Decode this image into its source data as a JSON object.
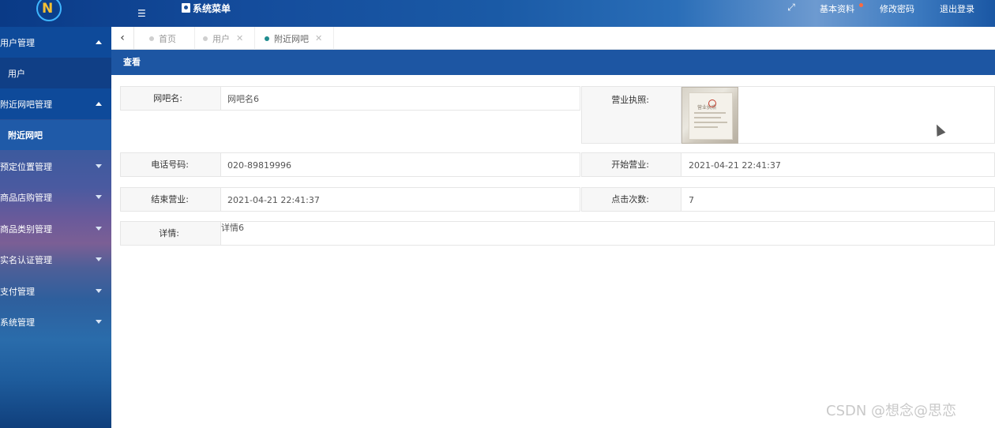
{
  "header": {
    "system_menu": "系统菜单",
    "links": [
      "基本资料",
      "修改密码",
      "退出登录"
    ],
    "colors": {
      "notify": "#ff6a3d"
    }
  },
  "sidebar": {
    "groups": [
      {
        "label": "用户管理",
        "expanded": true,
        "children": [
          "用户"
        ]
      },
      {
        "label": "附近网吧管理",
        "expanded": true,
        "children": [
          "附近网吧"
        ]
      },
      {
        "label": "预定位置管理",
        "expanded": false
      },
      {
        "label": "商品店购管理",
        "expanded": false
      },
      {
        "label": "商品类别管理",
        "expanded": false
      },
      {
        "label": "实名认证管理",
        "expanded": false
      },
      {
        "label": "支付管理",
        "expanded": false
      },
      {
        "label": "系统管理",
        "expanded": false
      }
    ]
  },
  "tabs": [
    {
      "label": "首页",
      "active": false
    },
    {
      "label": "用户",
      "active": false
    },
    {
      "label": "附近网吧",
      "active": true
    }
  ],
  "panel": {
    "title": "查看",
    "fields": {
      "name_label": "网吧名:",
      "name_value": "网吧名6",
      "license_label": "营业执照:",
      "license_image_text": "营业执照",
      "phone_label": "电话号码:",
      "phone_value": "020-89819996",
      "start_label": "开始营业:",
      "start_value": "2021-04-21 22:41:37",
      "end_label": "结束营业:",
      "end_value": "2021-04-21 22:41:37",
      "clicks_label": "点击次数:",
      "clicks_value": "7",
      "detail_label": "详情:",
      "detail_value": "详情6"
    }
  },
  "watermark": "CSDN @想念@思恋"
}
